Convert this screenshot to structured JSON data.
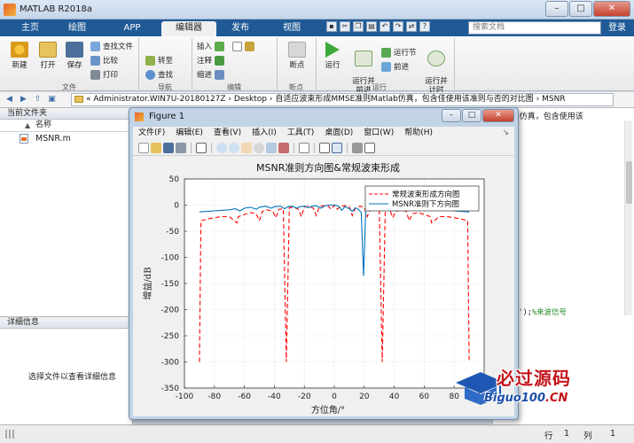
{
  "window": {
    "title": "MATLAB R2018a"
  },
  "tabs": [
    {
      "label": "主页"
    },
    {
      "label": "绘图"
    },
    {
      "label": "APP"
    },
    {
      "label": "编辑器"
    },
    {
      "label": "发布"
    },
    {
      "label": "视图"
    }
  ],
  "search": {
    "placeholder": "搜索文档"
  },
  "login_label": "登录",
  "ribbon": {
    "file": {
      "new": "新建",
      "open": "打开",
      "save": "保存",
      "find_files": "查找文件",
      "compare": "比较",
      "print": "打印",
      "group": "文件"
    },
    "navigate": {
      "goto": "转至",
      "find": "查找",
      "group": "导航"
    },
    "edit": {
      "insert": "插入",
      "comment": "注释",
      "indent": "缩进",
      "group": "编辑"
    },
    "breakpoints": {
      "breakpoints": "断点",
      "group": "断点"
    },
    "run": {
      "run": "运行",
      "run_advance": "运行并\n前进",
      "run_section": "运行节",
      "advance": "前进",
      "run_time": "运行并\n计时",
      "group": "运行"
    }
  },
  "address": {
    "path": "« Administrator.WIN7U-20180127Z › Desktop › 自适应波束形成MMSE准则Matlab仿真，包含佳使用该准则与否的对比图 › MSNR"
  },
  "current_folder": {
    "title": "当前文件夹",
    "column": "名称",
    "files": [
      {
        "name": "MSNR.m"
      }
    ]
  },
  "details": {
    "title": "详细信息",
    "message": "选择文件以查看详细信息"
  },
  "editor": {
    "tab_text": "lab仿真，包含使用该",
    "code_line": "m-1]');",
    "code_comment": "%来波信号"
  },
  "statusbar": {
    "row_label": "行",
    "row_value": "1",
    "col_label": "列",
    "col_value": "1"
  },
  "figure": {
    "title": "Figure 1",
    "menu": [
      "文件(F)",
      "编辑(E)",
      "查看(V)",
      "插入(I)",
      "工具(T)",
      "桌面(D)",
      "窗口(W)",
      "帮助(H)"
    ]
  },
  "colors": {
    "tab_bar": "#1f5a96",
    "series_red": "#ff0000",
    "series_blue": "#0072bd"
  },
  "watermark": {
    "text_cn": "必过源码",
    "text_en": "Biguo100.CN"
  },
  "chart_data": {
    "type": "line",
    "title": "MSNR准则方向图&常规波束形成",
    "xlabel": "方位角/°",
    "ylabel": "增益/dB",
    "xlim": [
      -100,
      100
    ],
    "ylim": [
      -350,
      50
    ],
    "xticks": [
      -100,
      -80,
      -60,
      -40,
      -20,
      0,
      20,
      40,
      60,
      80,
      100
    ],
    "yticks": [
      50,
      0,
      -50,
      -100,
      -150,
      -200,
      -250,
      -300,
      -350
    ],
    "legend_position": "top-right",
    "series": [
      {
        "name": "常规波束形成方向图",
        "style": "dashed",
        "color": "#ff0000",
        "points": [
          [
            -90,
            -300
          ],
          [
            -89,
            -30
          ],
          [
            -85,
            -27
          ],
          [
            -80,
            -24
          ],
          [
            -75,
            -22
          ],
          [
            -70,
            -22
          ],
          [
            -65,
            -34
          ],
          [
            -64,
            -22
          ],
          [
            -60,
            -18
          ],
          [
            -56,
            -14
          ],
          [
            -52,
            -17
          ],
          [
            -50,
            -30
          ],
          [
            -48,
            -12
          ],
          [
            -45,
            -9
          ],
          [
            -41,
            -12
          ],
          [
            -39,
            -24
          ],
          [
            -37,
            -8
          ],
          [
            -34,
            -7
          ],
          [
            -32,
            -300
          ],
          [
            -30,
            -5
          ],
          [
            -27,
            -4
          ],
          [
            -24,
            -8
          ],
          [
            -22,
            -22
          ],
          [
            -20,
            -4
          ],
          [
            -17,
            -2
          ],
          [
            -14,
            -6
          ],
          [
            -12,
            -20
          ],
          [
            -10,
            -3
          ],
          [
            -7,
            -1
          ],
          [
            -4,
            -2
          ],
          [
            -2,
            -8
          ],
          [
            0,
            0
          ],
          [
            2,
            -8
          ],
          [
            4,
            -2
          ],
          [
            7,
            -1
          ],
          [
            10,
            -3
          ],
          [
            12,
            -20
          ],
          [
            14,
            -6
          ],
          [
            17,
            -2
          ],
          [
            20,
            -4
          ],
          [
            22,
            -22
          ],
          [
            24,
            -8
          ],
          [
            27,
            -4
          ],
          [
            30,
            -5
          ],
          [
            32,
            -300
          ],
          [
            34,
            -7
          ],
          [
            37,
            -8
          ],
          [
            39,
            -24
          ],
          [
            41,
            -12
          ],
          [
            45,
            -9
          ],
          [
            48,
            -12
          ],
          [
            50,
            -30
          ],
          [
            52,
            -17
          ],
          [
            56,
            -14
          ],
          [
            60,
            -18
          ],
          [
            64,
            -22
          ],
          [
            65,
            -34
          ],
          [
            70,
            -22
          ],
          [
            75,
            -22
          ],
          [
            80,
            -24
          ],
          [
            85,
            -27
          ],
          [
            89,
            -30
          ],
          [
            90,
            -300
          ]
        ]
      },
      {
        "name": "MSNR准则下方向图",
        "style": "solid",
        "color": "#0072bd",
        "points": [
          [
            -90,
            -13
          ],
          [
            -85,
            -12
          ],
          [
            -80,
            -11
          ],
          [
            -75,
            -10
          ],
          [
            -70,
            -9
          ],
          [
            -66,
            -7
          ],
          [
            -63,
            -11
          ],
          [
            -60,
            -6
          ],
          [
            -56,
            -4
          ],
          [
            -52,
            -8
          ],
          [
            -50,
            -4
          ],
          [
            -46,
            -2
          ],
          [
            -42,
            -6
          ],
          [
            -40,
            -3
          ],
          [
            -36,
            -2
          ],
          [
            -33,
            -7
          ],
          [
            -31,
            -3
          ],
          [
            -28,
            -2
          ],
          [
            -25,
            -6
          ],
          [
            -23,
            -3
          ],
          [
            -20,
            -2
          ],
          [
            -17,
            -5
          ],
          [
            -15,
            -2
          ],
          [
            -12,
            -1
          ],
          [
            -9,
            -6
          ],
          [
            -6,
            -1
          ],
          [
            -3,
            0
          ],
          [
            0,
            0
          ],
          [
            3,
            -2
          ],
          [
            5,
            -10
          ],
          [
            7,
            -3
          ],
          [
            10,
            -7
          ],
          [
            12,
            -12
          ],
          [
            14,
            -5
          ],
          [
            16,
            -8
          ],
          [
            18,
            -14
          ],
          [
            19.5,
            -135
          ],
          [
            21,
            -10
          ],
          [
            23,
            -4
          ],
          [
            26,
            -8
          ],
          [
            28,
            -3
          ],
          [
            31,
            -6
          ],
          [
            34,
            -2
          ],
          [
            37,
            -5
          ],
          [
            40,
            -2
          ],
          [
            44,
            -6
          ],
          [
            47,
            -3
          ],
          [
            51,
            -7
          ],
          [
            55,
            -4
          ],
          [
            60,
            -8
          ],
          [
            65,
            -6
          ],
          [
            70,
            -10
          ],
          [
            75,
            -9
          ],
          [
            80,
            -11
          ],
          [
            85,
            -12
          ],
          [
            90,
            -13
          ]
        ]
      }
    ]
  }
}
